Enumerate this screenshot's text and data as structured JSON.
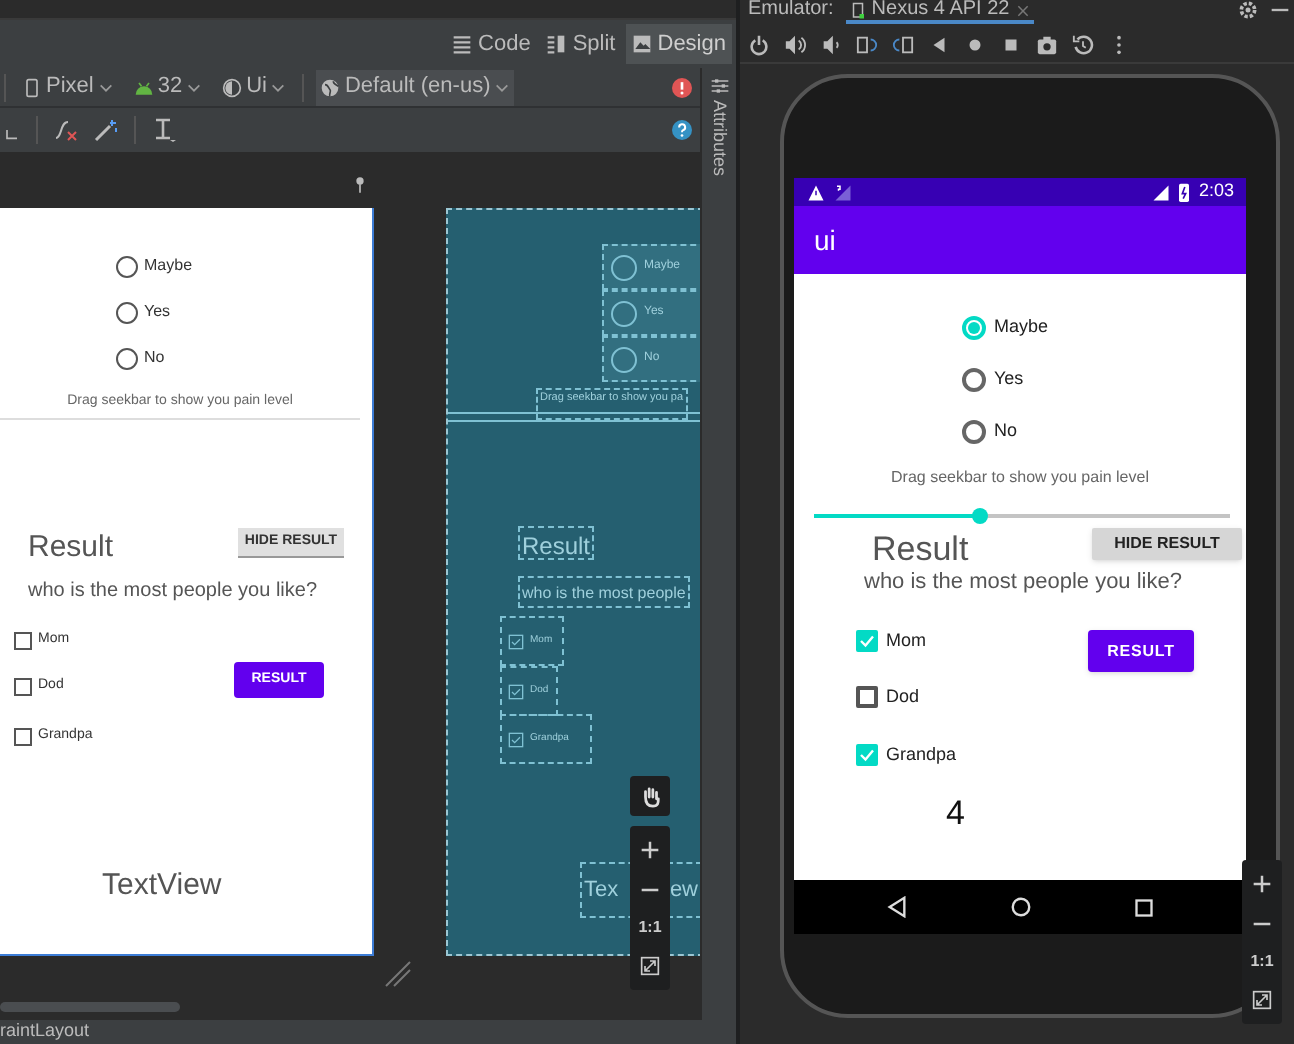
{
  "editor": {
    "view_modes": [
      {
        "label": "Code",
        "selected": false
      },
      {
        "label": "Split",
        "selected": false
      },
      {
        "label": "Design",
        "selected": true
      }
    ],
    "toolbar": {
      "device": "Pixel",
      "api": "32",
      "theme": "Ui",
      "locale": "Default (en-us)"
    },
    "attributes_tab": "Attributes",
    "design_preview": {
      "radios": [
        {
          "label": "Maybe",
          "selected": false
        },
        {
          "label": "Yes",
          "selected": false
        },
        {
          "label": "No",
          "selected": false
        }
      ],
      "hint": "Drag seekbar to show you pain level",
      "title": "Result",
      "hide_button": "HIDE RESULT",
      "question": "who is the most people you like?",
      "checkboxes": [
        {
          "label": "Mom",
          "checked": false
        },
        {
          "label": "Dod",
          "checked": false
        },
        {
          "label": "Grandpa",
          "checked": false
        }
      ],
      "result_button": "RESULT",
      "text_view": "TextView"
    },
    "blueprint": {
      "radios": [
        "Maybe",
        "Yes",
        "No"
      ],
      "hint": "Drag seekbar to show you pa",
      "title": "Result",
      "question": "who is the most people",
      "checkboxes": [
        "Mom",
        "Dod",
        "Grandpa"
      ],
      "text_view_start": "Tex",
      "text_view_end": "ew"
    },
    "zoom_label": "1:1",
    "status_bar": "raintLayout"
  },
  "emulator": {
    "label": "Emulator:",
    "tab": "Nexus 4 API 22",
    "phone": {
      "time": "2:03",
      "app_title": "ui",
      "radios": [
        {
          "label": "Maybe",
          "selected": true
        },
        {
          "label": "Yes",
          "selected": false
        },
        {
          "label": "No",
          "selected": false
        }
      ],
      "hint": "Drag seekbar to show you pain level",
      "seekbar": {
        "level": 0.4
      },
      "title": "Result",
      "hide_button": "HIDE RESULT",
      "question": "who is the most people you like?",
      "checkboxes": [
        {
          "label": "Mom",
          "checked": true
        },
        {
          "label": "Dod",
          "checked": false
        },
        {
          "label": "Grandpa",
          "checked": true
        }
      ],
      "result_button": "RESULT",
      "count": "4"
    },
    "zoom_label": "1:1"
  }
}
